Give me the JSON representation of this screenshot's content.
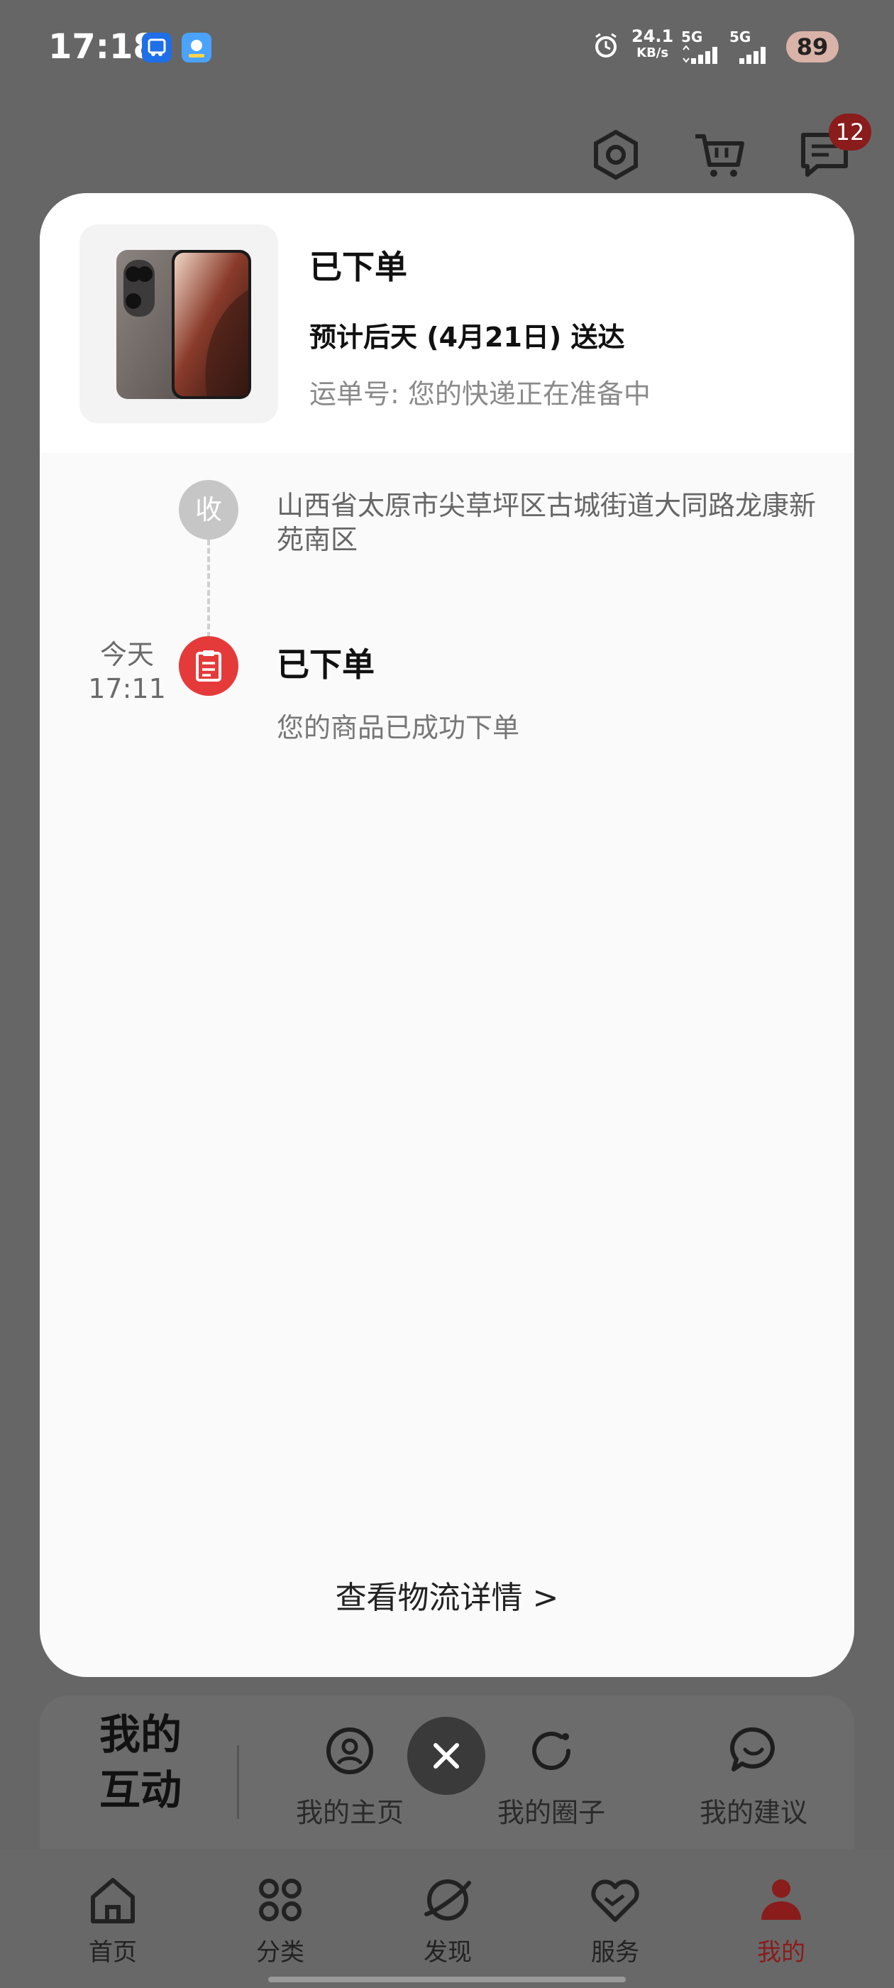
{
  "status_bar": {
    "time": "17:18",
    "net_speed_value": "24.1",
    "net_speed_unit": "KB/s",
    "signal_1": "5G",
    "signal_2": "5G",
    "battery": "89"
  },
  "header": {
    "message_badge": "12"
  },
  "order_modal": {
    "status_title": "已下单",
    "eta": "预计后天 (4月21日) 送达",
    "tracking": "运单号: 您的快递正在准备中",
    "timeline": {
      "receive_node_label": "收",
      "receive_address": "山西省太原市尖草坪区古城街道大同路龙康新苑南区",
      "event_time_day": "今天",
      "event_time_clock": "17:11",
      "event_title": "已下单",
      "event_desc": "您的商品已成功下单"
    },
    "detail_link": "查看物流详情 >"
  },
  "interaction": {
    "title_line1": "我的",
    "title_line2": "互动",
    "items": [
      {
        "label": "我的主页",
        "icon": "user-circle-icon"
      },
      {
        "label": "我的圈子",
        "icon": "refresh-circle-icon"
      },
      {
        "label": "我的建议",
        "icon": "feedback-bubble-icon"
      }
    ]
  },
  "bottom_nav": {
    "items": [
      {
        "label": "首页",
        "icon": "home-icon"
      },
      {
        "label": "分类",
        "icon": "category-grid-icon"
      },
      {
        "label": "发现",
        "icon": "planet-icon"
      },
      {
        "label": "服务",
        "icon": "heart-service-icon"
      },
      {
        "label": "我的",
        "icon": "person-icon",
        "active": true
      }
    ]
  },
  "colors": {
    "accent_red": "#e53a3a",
    "active_nav": "#8a1c1c",
    "overlay": "#666666"
  }
}
